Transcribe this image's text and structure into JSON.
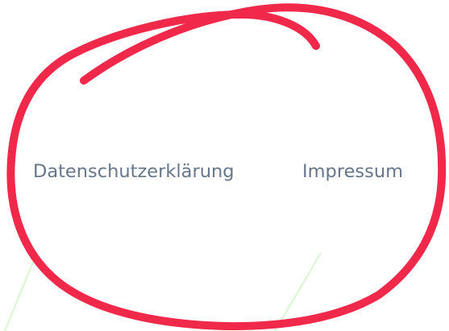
{
  "footer": {
    "links": [
      {
        "label": "Datenschutzerklärung"
      },
      {
        "label": "Impressum"
      }
    ]
  },
  "colors": {
    "link_text": "#66768b",
    "annotation_circle": "#f0284a",
    "decorative_lines": "#d8f7cf",
    "background": "#ffffff"
  },
  "annotation": {
    "shape": "hand-drawn-circle"
  }
}
